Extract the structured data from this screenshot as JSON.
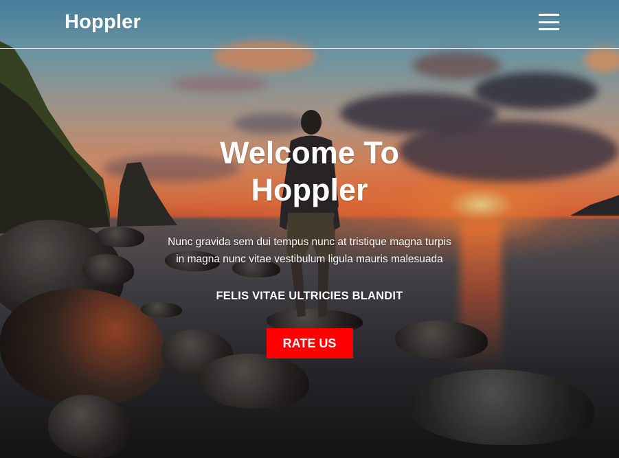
{
  "brand": "Hoppler",
  "nav": {
    "menu_icon": "hamburger-menu-icon"
  },
  "hero": {
    "title": "Welcome To Hoppler",
    "lead": "Nunc gravida sem dui tempus nunc at tristique magna turpis in magna nunc vitae vestibulum ligula mauris malesuada",
    "subheading": "FELIS VITAE ULTRICIES BLANDIT",
    "cta_label": "RATE US",
    "cta_color": "#ff0000"
  }
}
